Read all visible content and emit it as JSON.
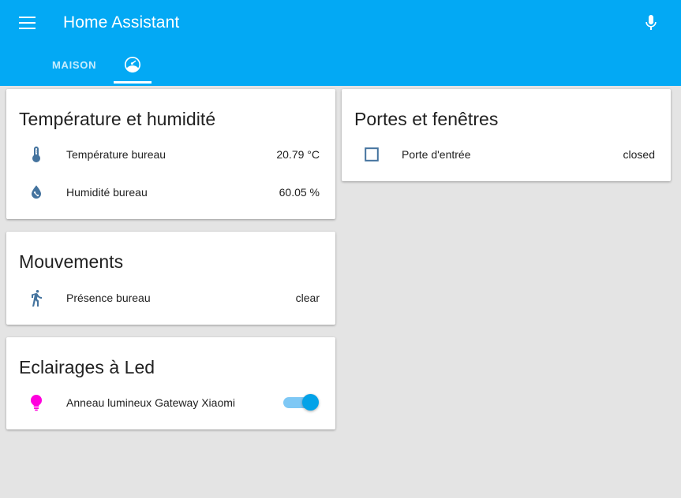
{
  "header": {
    "title": "Home Assistant",
    "menu_icon": "hamburger-menu-icon",
    "mic_icon": "microphone-icon",
    "accent_color": "#03a9f4"
  },
  "tabs": [
    {
      "label": "MAISON",
      "type": "text",
      "active": false
    },
    {
      "label": "",
      "type": "icon",
      "icon": "gauge-icon",
      "active": true
    }
  ],
  "columns": [
    {
      "cards": [
        {
          "title": "Température et humidité",
          "rows": [
            {
              "icon": "thermometer-icon",
              "icon_color": "#44739e",
              "name": "Température bureau",
              "state": "20.79 °C",
              "control": "text"
            },
            {
              "icon": "water-percent-icon",
              "icon_color": "#44739e",
              "name": "Humidité bureau",
              "state": "60.05 %",
              "control": "text"
            }
          ]
        },
        {
          "title": "Mouvements",
          "rows": [
            {
              "icon": "walk-icon",
              "icon_color": "#44739e",
              "name": "Présence bureau",
              "state": "clear",
              "control": "text"
            }
          ]
        },
        {
          "title": "Eclairages à Led",
          "rows": [
            {
              "icon": "lightbulb-icon",
              "icon_color": "#ff00dd",
              "name": "Anneau lumineux Gateway Xiaomi",
              "state": "",
              "control": "toggle",
              "toggle_on": true
            }
          ]
        }
      ]
    },
    {
      "cards": [
        {
          "title": "Portes et fenêtres",
          "rows": [
            {
              "icon": "square-outline-icon",
              "icon_color": "#44739e",
              "name": "Porte d'entrée",
              "state": "closed",
              "control": "text"
            }
          ]
        }
      ]
    }
  ],
  "theme": {
    "background": "#e4e4e4",
    "card_background": "#ffffff",
    "primary_text": "#212121",
    "state_icon_color": "#44739e",
    "toggle_on_color": "#03a2e8"
  }
}
